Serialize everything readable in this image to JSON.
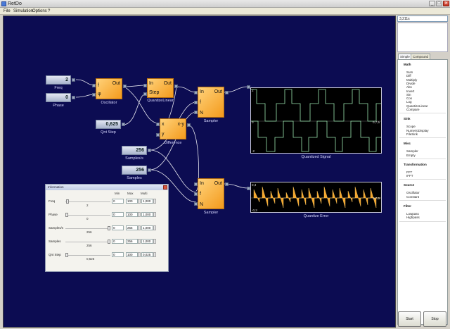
{
  "window": {
    "title": "RetDo",
    "min": "_",
    "max": "□",
    "close": "✕"
  },
  "menu": [
    {
      "label": "File"
    },
    {
      "label": "Simulation"
    },
    {
      "label": "Options"
    },
    {
      "label": "?"
    }
  ],
  "constants": {
    "freq": {
      "value": "2",
      "label": "Freq"
    },
    "phase": {
      "value": "0",
      "label": "Phase"
    },
    "qnt_step": {
      "value": "0,625",
      "label": "Qnt Step"
    },
    "samples_s": {
      "value": "256",
      "label": "Samples/s"
    },
    "samples": {
      "value": "256",
      "label": "Samples"
    }
  },
  "blocks": {
    "oscillator": {
      "label": "Oscillator",
      "ports": {
        "f": "f",
        "phi": "φ",
        "out": "Out"
      }
    },
    "quantize": {
      "label": "QuantizeLinear",
      "ports": {
        "in": "In",
        "step": "Step",
        "out": "Out"
      }
    },
    "difference": {
      "label": "Difference",
      "ports": {
        "x": "x",
        "y": "y",
        "out": "x-y"
      }
    },
    "sampler1": {
      "label": "Sampler",
      "ports": {
        "in": "In",
        "f": "f",
        "n": "N",
        "out": "Out"
      }
    },
    "sampler2": {
      "label": "Sampler",
      "ports": {
        "in": "In",
        "f": "f",
        "n": "N",
        "out": "Out"
      }
    }
  },
  "scopes": {
    "quantized": {
      "label": "Quantized Signal",
      "top_value": "2",
      "bottom_value": "-2",
      "mid_value": "0",
      "right_value": "0,7,5"
    },
    "error": {
      "label": "Quantize Error",
      "top_value": "0,3",
      "bottom_value": "-0,3",
      "right_value": "0,7,5"
    }
  },
  "param_window": {
    "title": "Information",
    "headers": {
      "min": "Min",
      "max": "Max",
      "multi": "Multi"
    },
    "rows": [
      {
        "name": "Freq",
        "value": "2",
        "min": "0",
        "max": "100",
        "multi": "1,000",
        "pos": 0.02
      },
      {
        "name": "Phase",
        "value": "0",
        "min": "0",
        "max": "100",
        "multi": "1,000",
        "pos": 0.0
      },
      {
        "name": "Samples/s",
        "value": "256",
        "min": "0",
        "max": "256",
        "multi": "1,000",
        "pos": 1.0
      },
      {
        "name": "Samples",
        "value": "256",
        "min": "0",
        "max": "256",
        "multi": "1,000",
        "pos": 1.0
      },
      {
        "name": "Qnt Step",
        "value": "0,625",
        "min": "0",
        "max": "100",
        "multi": "0,025",
        "pos": 0.0
      }
    ]
  },
  "right_panel": {
    "readout": "3,211s",
    "tabs": [
      {
        "label": "Simple"
      },
      {
        "label": "Compound"
      }
    ],
    "toolbox": [
      {
        "category": "Math",
        "items": [
          "Sum",
          "Diff",
          "Multiply",
          "Divide",
          "Abs",
          "Invert",
          "Sin",
          "Cos",
          "Log",
          "QuantizeLinear",
          "Compare"
        ]
      },
      {
        "category": "Sink",
        "items": [
          "Scope",
          "NumericDisplay",
          "FileSink"
        ]
      },
      {
        "category": "Misc",
        "items": [
          "Sampler",
          "Empty"
        ]
      },
      {
        "category": "Transformation",
        "items": [
          "FFT",
          "IFFT"
        ]
      },
      {
        "category": "Source",
        "items": [
          "Oscillator",
          "Constant"
        ]
      },
      {
        "category": "Filter",
        "items": [
          "Lowpass",
          "Highpass"
        ]
      }
    ],
    "start_label": "Start",
    "stop_label": "Stop"
  }
}
